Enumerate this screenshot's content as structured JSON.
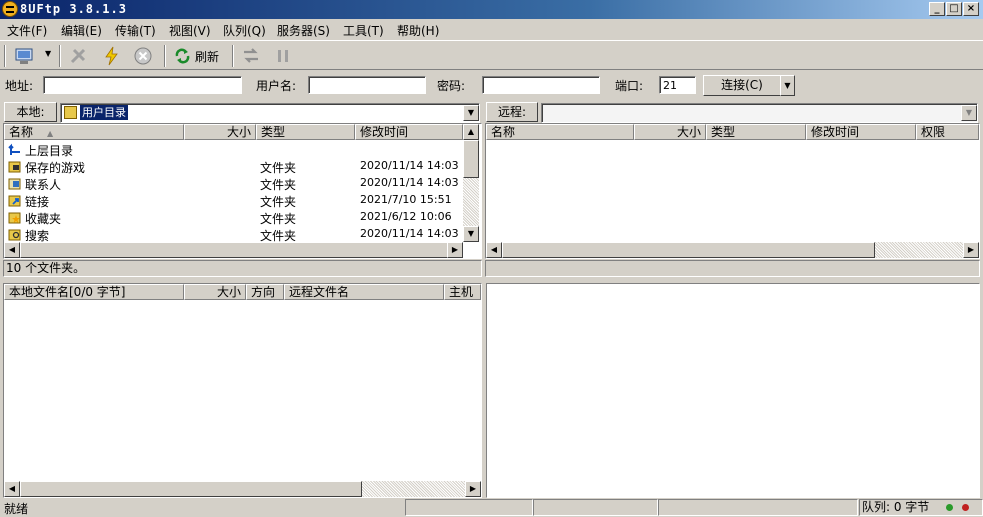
{
  "window": {
    "title": "8UFtp 3.8.1.3",
    "minimize": "_",
    "maximize": "□",
    "close": "×"
  },
  "menu": [
    "文件(F)",
    "编辑(E)",
    "传输(T)",
    "视图(V)",
    "队列(Q)",
    "服务器(S)",
    "工具(T)",
    "帮助(H)"
  ],
  "toolbar": {
    "refresh_label": "刷新",
    "dropdown_arrow": "▼"
  },
  "address": {
    "address_label": "地址:",
    "address_value": "",
    "username_label": "用户名:",
    "username_value": "",
    "password_label": "密码:",
    "password_value": "",
    "port_label": "端口:",
    "port_value": "21",
    "connect_label": "连接(C)",
    "connect_arrow": "▼"
  },
  "local": {
    "label": "本地:",
    "path": "用户目录",
    "columns": [
      "名称",
      "大小",
      "类型",
      "修改时间"
    ],
    "rows": [
      {
        "name": "上层目录",
        "size": "",
        "type": "",
        "time": ""
      },
      {
        "name": "保存的游戏",
        "size": "",
        "type": "文件夹",
        "time": "2020/11/14 14:03"
      },
      {
        "name": "联系人",
        "size": "",
        "type": "文件夹",
        "time": "2020/11/14 14:03"
      },
      {
        "name": "链接",
        "size": "",
        "type": "文件夹",
        "time": "2021/7/10 15:51"
      },
      {
        "name": "收藏夹",
        "size": "",
        "type": "文件夹",
        "time": "2021/6/12 10:06"
      },
      {
        "name": "搜索",
        "size": "",
        "type": "文件夹",
        "time": "2020/11/14 14:03"
      }
    ],
    "status": "10 个文件夹。"
  },
  "remote": {
    "label": "远程:",
    "path": "",
    "columns": [
      "名称",
      "大小",
      "类型",
      "修改时间",
      "权限"
    ]
  },
  "queue": {
    "columns": [
      "本地文件名[0/0 字节]",
      "大小",
      "方向",
      "远程文件名",
      "主机"
    ]
  },
  "statusbar": {
    "ready": "就绪",
    "queue": "队列: 0 字节"
  },
  "colors": {
    "titlebar": "#0a246a",
    "selection": "#0a246a",
    "face": "#d4d0c8"
  }
}
